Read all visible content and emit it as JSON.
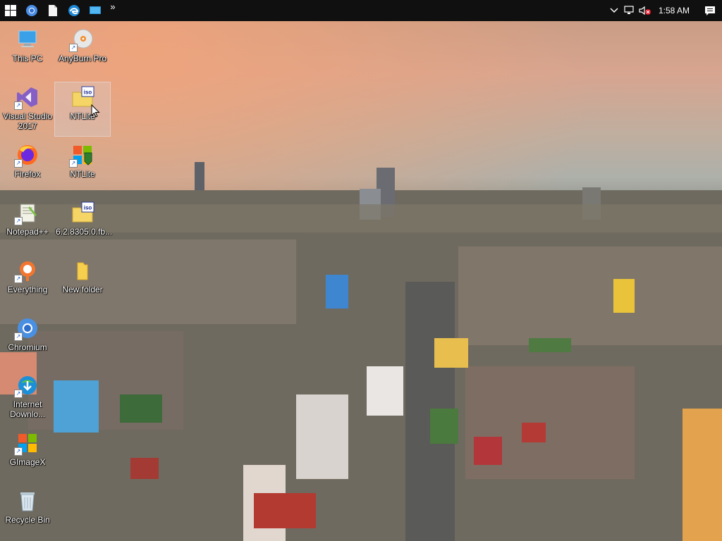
{
  "taskbar": {
    "start_icon": "windows-logo-icon",
    "pinned": [
      {
        "name": "chromium-icon"
      },
      {
        "name": "file-icon"
      },
      {
        "name": "edge-icon"
      },
      {
        "name": "desktop-window-icon"
      }
    ],
    "overflow_label": "»",
    "tray": {
      "chevron_icon": "chevron-up-icon",
      "network_icon": "network-icon",
      "volume_icon": "volume-muted-icon"
    },
    "clock": "1:58 AM",
    "notifications_icon": "action-center-icon"
  },
  "desktop": {
    "icons": [
      {
        "label": "This PC",
        "icon": "computer-icon"
      },
      {
        "label": "AnyBurn Pro",
        "icon": "disc-burn-icon"
      },
      {
        "label": "Visual Studio 2017",
        "icon": "visual-studio-icon"
      },
      {
        "label": "NTLite",
        "icon": "iso-file-icon",
        "selected": true
      },
      {
        "label": "Firefox",
        "icon": "firefox-icon"
      },
      {
        "label": "NTLite",
        "icon": "ntlite-icon"
      },
      {
        "label": "Notepad++",
        "icon": "notepad-plus-plus-icon"
      },
      {
        "label": "6.2.8305.0.fb...",
        "icon": "iso-file-icon"
      },
      {
        "label": "Everything",
        "icon": "everything-search-icon"
      },
      {
        "label": "New folder",
        "icon": "folder-icon"
      },
      {
        "label": "Chromium",
        "icon": "chromium-icon"
      },
      {
        "label": "Internet Downlo...",
        "icon": "internet-download-manager-icon"
      },
      {
        "label": "GImageX",
        "icon": "gimagex-icon"
      },
      {
        "label": "Recycle Bin",
        "icon": "recycle-bin-icon"
      }
    ]
  }
}
